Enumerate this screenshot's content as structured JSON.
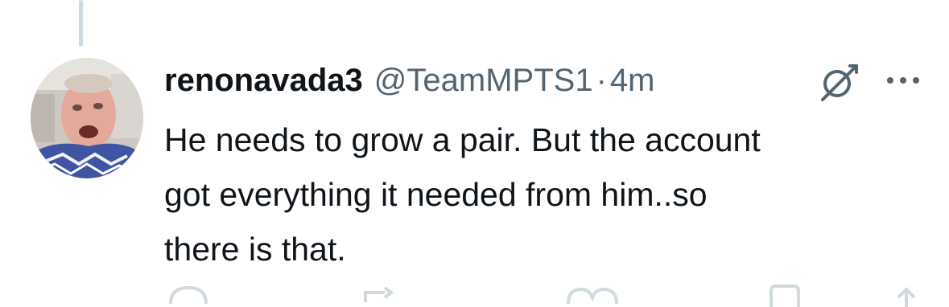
{
  "tweet": {
    "display_name": "renonavada3",
    "handle": "@TeamMPTS1",
    "separator": "·",
    "timestamp": "4m",
    "text": "He needs to grow a pair. But the account\ngot everything it needed from him..so\nthere is that."
  },
  "icons": {
    "grok": "grok-icon",
    "more": "more-icon",
    "reply": "reply-icon",
    "repost": "repost-icon",
    "like": "like-icon",
    "bookmark": "bookmark-icon",
    "share": "share-icon"
  },
  "colors": {
    "primary_text": "#0f1419",
    "secondary_text": "#536471",
    "thread_line": "#cfd9de"
  }
}
